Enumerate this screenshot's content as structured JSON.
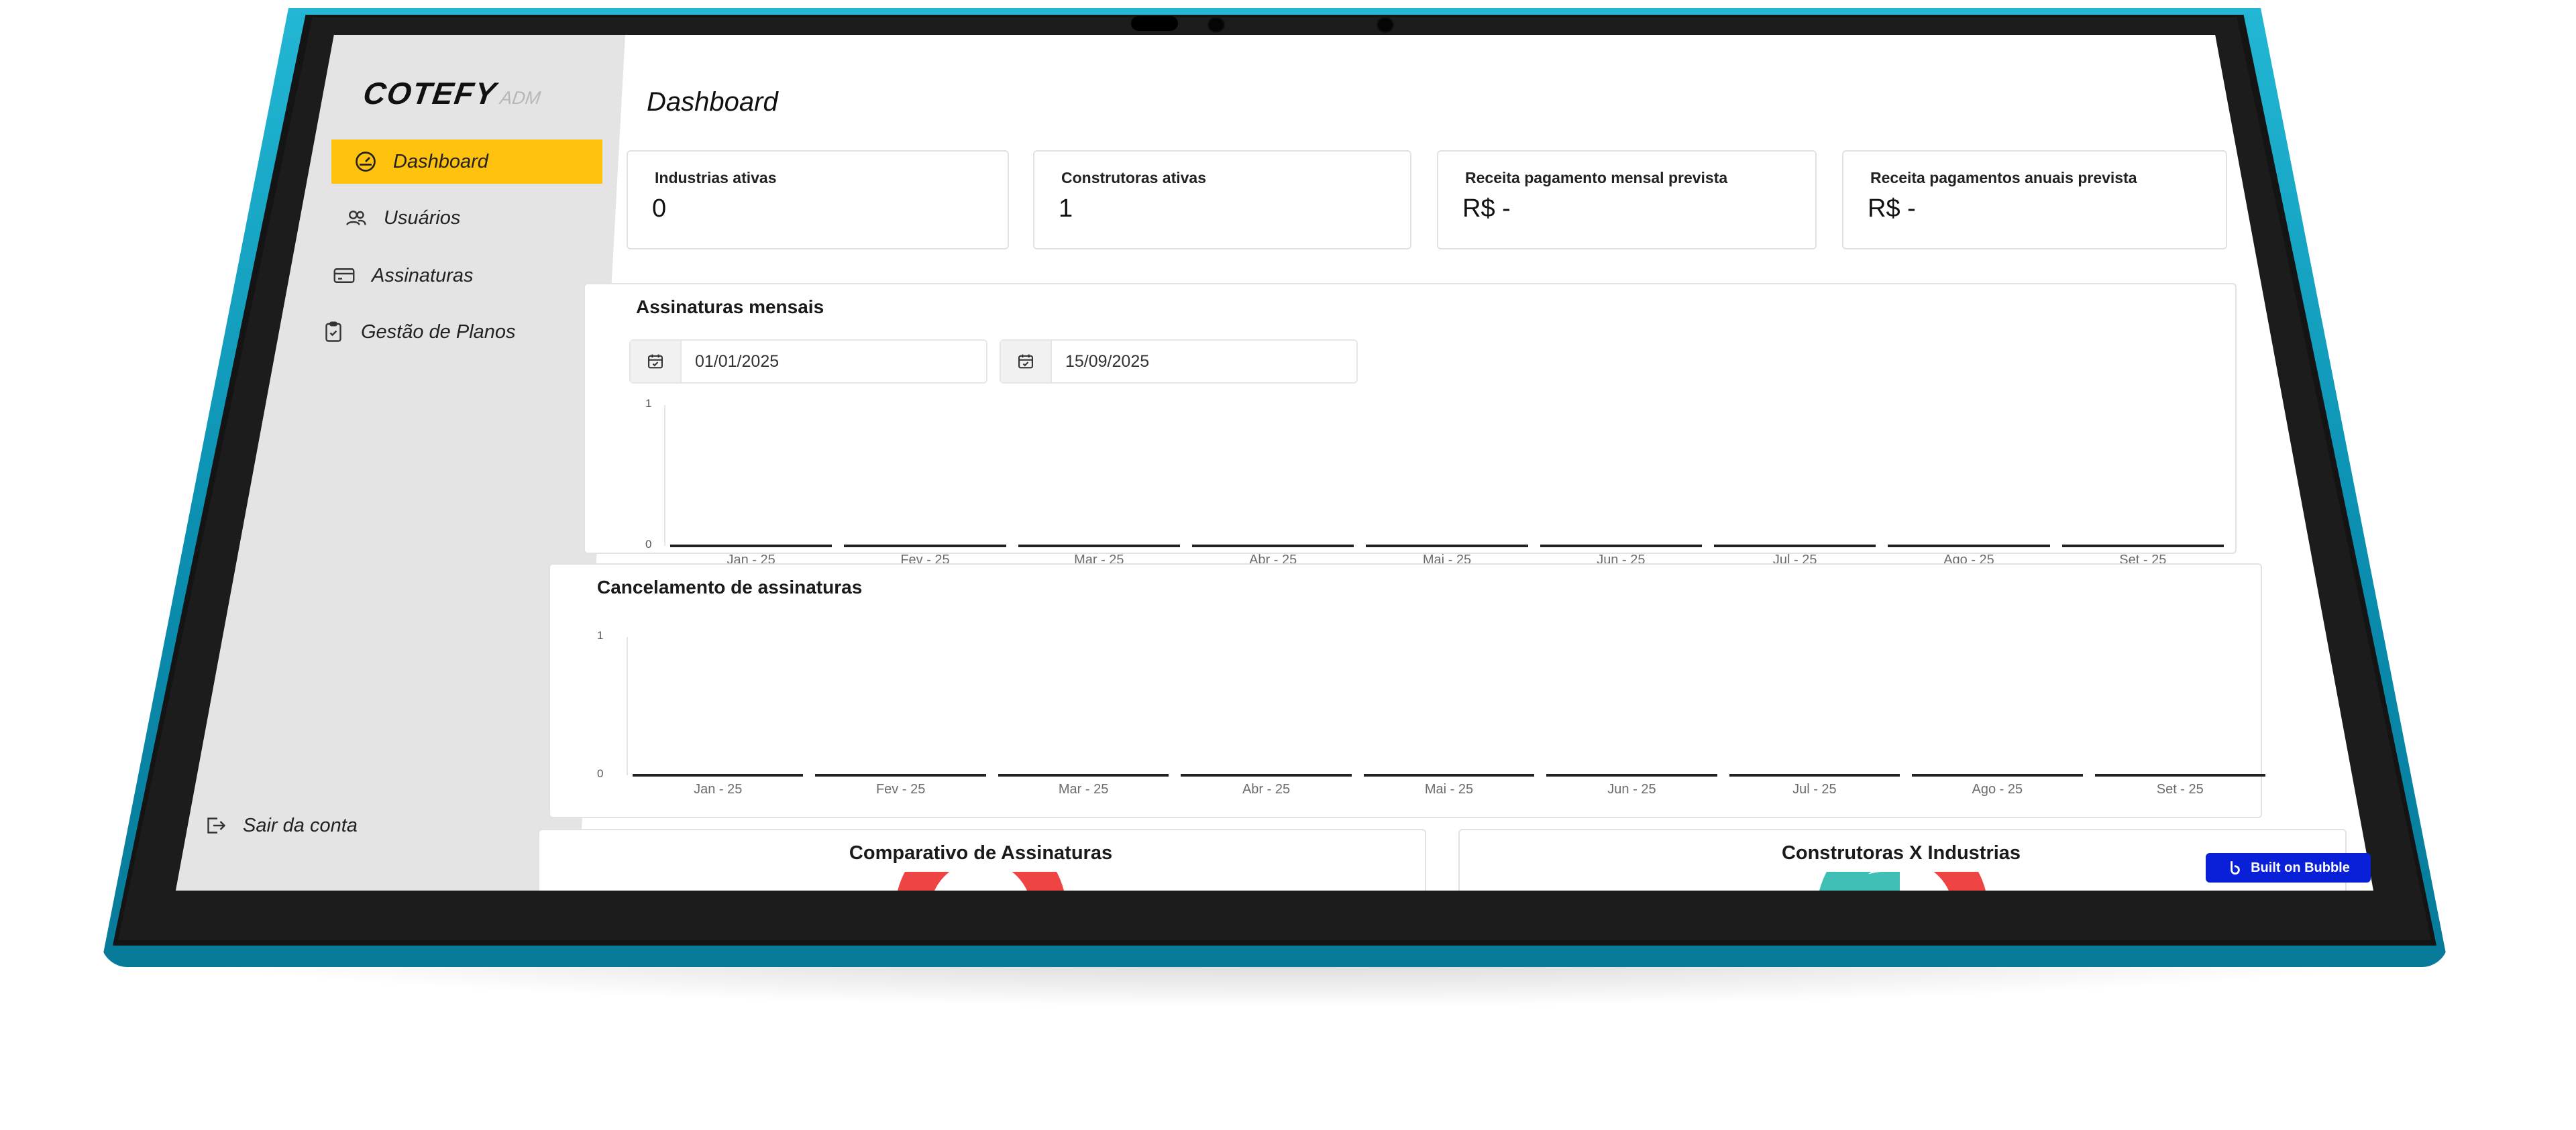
{
  "brand": {
    "logo": "COTEFY",
    "suffix": "ADM"
  },
  "sidebar": {
    "items": [
      {
        "label": "Dashboard",
        "icon": "gauge-icon",
        "active": true
      },
      {
        "label": "Usuários",
        "icon": "users-icon",
        "active": false
      },
      {
        "label": "Assinaturas",
        "icon": "credit-card-icon",
        "active": false
      },
      {
        "label": "Gestão de Planos",
        "icon": "clipboard-check-icon",
        "active": false
      }
    ],
    "logout": {
      "label": "Sair da conta",
      "icon": "logout-icon"
    }
  },
  "page": {
    "title": "Dashboard"
  },
  "stats": [
    {
      "label": "Industrias ativas",
      "value": "0"
    },
    {
      "label": "Construtoras ativas",
      "value": "1"
    },
    {
      "label": "Receita pagamento mensal prevista",
      "value": "R$ -"
    },
    {
      "label": "Receita pagamentos anuais prevista",
      "value": "R$ -"
    }
  ],
  "monthly": {
    "title": "Assinaturas mensais",
    "start_date": "01/01/2025",
    "end_date": "15/09/2025"
  },
  "cancel": {
    "title": "Cancelamento de assinaturas"
  },
  "chart_data": [
    {
      "type": "bar",
      "title": "Assinaturas mensais",
      "categories": [
        "Jan - 25",
        "Fev - 25",
        "Mar - 25",
        "Abr - 25",
        "Mai - 25",
        "Jun - 25",
        "Jul - 25",
        "Ago - 25",
        "Set - 25"
      ],
      "values": [
        0,
        0,
        0,
        0,
        0,
        0,
        0,
        0,
        0
      ],
      "ylim": [
        0,
        1
      ],
      "yticks": [
        "0",
        "1"
      ]
    },
    {
      "type": "bar",
      "title": "Cancelamento de assinaturas",
      "categories": [
        "Jan - 25",
        "Fev - 25",
        "Mar - 25",
        "Abr - 25",
        "Mai - 25",
        "Jun - 25",
        "Jul - 25",
        "Ago - 25",
        "Set - 25"
      ],
      "values": [
        0,
        0,
        0,
        0,
        0,
        0,
        0,
        0,
        0
      ],
      "ylim": [
        0,
        1
      ],
      "yticks": [
        "0",
        "1"
      ]
    }
  ],
  "donuts": [
    {
      "title": "Comparativo de Assinaturas",
      "colors": [
        "#ef4444",
        "#ef4444"
      ]
    },
    {
      "title": "Construtoras X Industrias",
      "colors": [
        "#3fbfb5",
        "#ef4444"
      ]
    }
  ],
  "badge": {
    "label": "Built on Bubble"
  },
  "colors": {
    "accent": "#ffc20e",
    "frame": "#12a3c4",
    "badge": "#0a1fd8"
  }
}
